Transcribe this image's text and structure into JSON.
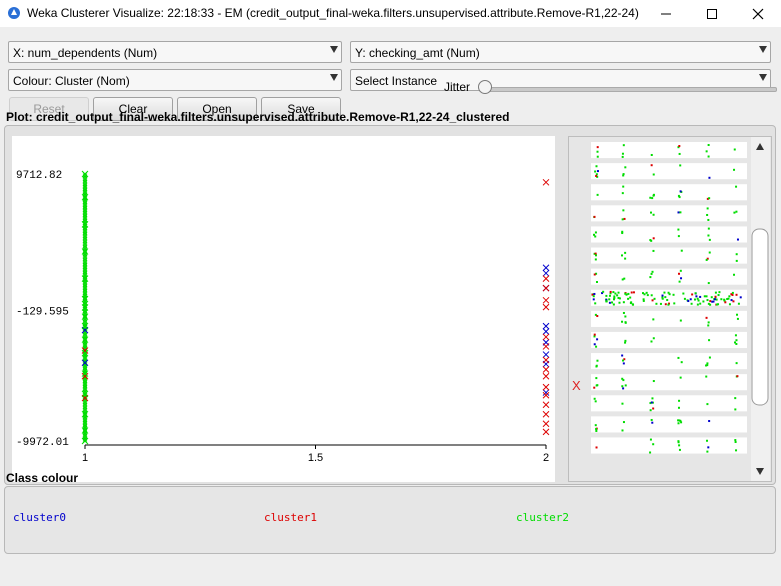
{
  "window": {
    "title": "Weka Clusterer Visualize: 22:18:33 - EM (credit_output_final-weka.filters.unsupervised.attribute.Remove-R1,22-24)"
  },
  "controls": {
    "x_axis": "X: num_dependents (Num)",
    "y_axis": "Y: checking_amt (Num)",
    "colour": "Colour: Cluster (Nom)",
    "select_instance": "Select Instance",
    "reset_label": "Reset",
    "clear_label": "Clear",
    "open_label": "Open",
    "save_label": "Save",
    "jitter_label": "Jitter",
    "jitter_value": 0
  },
  "plot": {
    "label": "Plot: credit_output_final-weka.filters.unsupervised.attribute.Remove-R1,22-24_clustered",
    "y_ticks": [
      "9712.82",
      "-129.595",
      "-9972.01"
    ],
    "x_ticks": [
      "1",
      "1.5",
      "2"
    ]
  },
  "chart_data": {
    "type": "scatter",
    "title": "",
    "xlabel": "num_dependents",
    "ylabel": "checking_amt",
    "xlim": [
      1,
      2
    ],
    "ylim": [
      -9972.01,
      9712.82
    ],
    "x_categories": [
      1,
      2
    ],
    "series": [
      {
        "name": "cluster0",
        "color": "#0000cc",
        "x": [
          2,
          2,
          2,
          2,
          2,
          2,
          2,
          2,
          2,
          1,
          1
        ],
        "y": [
          2800,
          2400,
          1300,
          -1500,
          -1900,
          -2700,
          -3600,
          -4300,
          -6400,
          -1800,
          -4200
        ]
      },
      {
        "name": "cluster1",
        "color": "#dd0000",
        "x": [
          2,
          2,
          2,
          2,
          2,
          2,
          2,
          2,
          2,
          2,
          2,
          2,
          2,
          2,
          2,
          2,
          1,
          1,
          1
        ],
        "y": [
          9100,
          400,
          2000,
          1300,
          -100,
          -2300,
          -3000,
          -4000,
          -4700,
          -5200,
          -6000,
          -6600,
          -7300,
          -8000,
          -8700,
          -9300,
          -3300,
          -5200,
          -6800
        ]
      },
      {
        "name": "cluster2",
        "color": "#00dd00",
        "x": [
          1,
          1,
          1,
          1,
          1,
          1,
          1,
          1,
          1,
          1,
          1,
          1,
          1,
          1,
          1,
          1
        ],
        "y": [
          9712,
          8000,
          6000,
          4000,
          2000,
          500,
          -130,
          -800,
          -1500,
          -2500,
          -3500,
          -5000,
          -6500,
          -8000,
          -9200,
          -9972
        ]
      }
    ]
  },
  "legend": {
    "label": "Class colour",
    "clusters": [
      {
        "name": "cluster0",
        "color": "#0000cc"
      },
      {
        "name": "cluster1",
        "color": "#dd0000"
      },
      {
        "name": "cluster2",
        "color": "#00dd00"
      }
    ]
  },
  "matrix": {
    "side_marker": "X",
    "rows": 15,
    "highlighted_row": 7
  }
}
